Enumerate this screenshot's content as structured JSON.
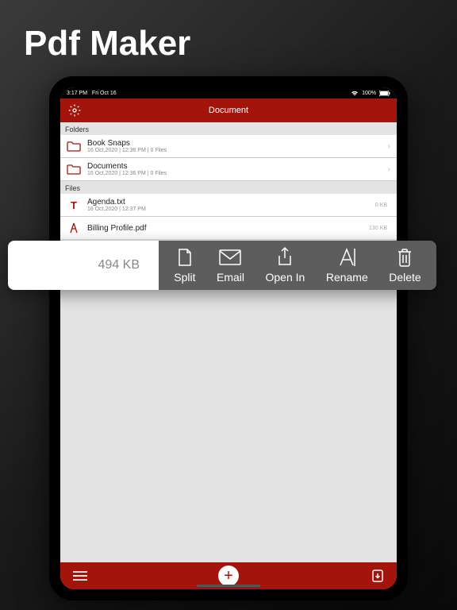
{
  "marketing_title": "Pdf Maker",
  "status": {
    "time": "3:17 PM",
    "date": "Fri Oct 16",
    "battery": "100%"
  },
  "nav": {
    "title": "Document"
  },
  "sections": {
    "folders_label": "Folders",
    "files_label": "Files"
  },
  "folders": [
    {
      "name": "Book Snaps",
      "meta": "16 Oct,2020 | 12:36 PM | 0 Files"
    },
    {
      "name": "Documents",
      "meta": "16 Oct,2020 | 12:36 PM | 0 Files"
    }
  ],
  "files": [
    {
      "name": "Agenda.txt",
      "meta": "16 Oct,2020 | 12:37 PM",
      "size": "0 KB",
      "type": "txt"
    },
    {
      "name": "Billing Profile.pdf",
      "meta": "",
      "size": "130 KB",
      "type": "pdf"
    }
  ],
  "sheet": {
    "size": "494 KB",
    "actions": {
      "split": "Split",
      "email": "Email",
      "openin": "Open In",
      "rename": "Rename",
      "delete": "Delete"
    }
  }
}
